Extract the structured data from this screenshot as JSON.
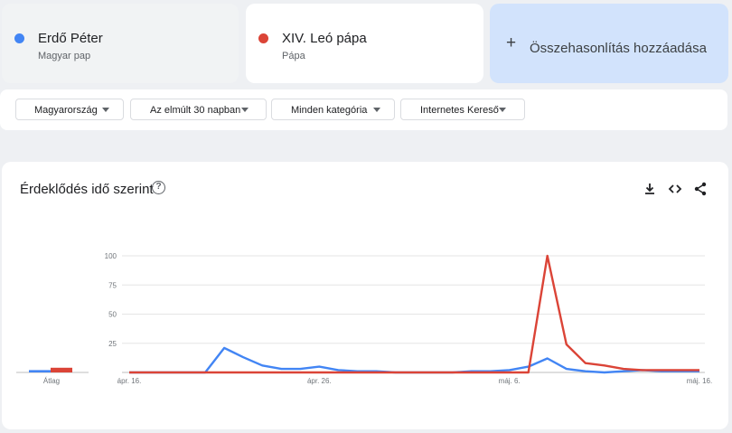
{
  "terms": [
    {
      "name": "Erdő Péter",
      "subtitle": "Magyar pap",
      "color": "#4285f4"
    },
    {
      "name": "XIV. Leó pápa",
      "subtitle": "Pápa",
      "color": "#db4437"
    }
  ],
  "add_compare": {
    "label": "Összehasonlítás hozzáadása",
    "icon": "plus-icon"
  },
  "filters": [
    {
      "label": "Magyarország"
    },
    {
      "label": "Az elmúlt 30 napban"
    },
    {
      "label": "Minden kategória"
    },
    {
      "label": "Internetes Kereső"
    }
  ],
  "chart_card": {
    "title": "Érdeklődés idő szerint",
    "help_icon": "?",
    "tools": [
      "download-icon",
      "embed-icon",
      "share-icon"
    ]
  },
  "chart_data": {
    "type": "line",
    "x_start": "ápr. 16.",
    "x_tick_labels": [
      "ápr. 16.",
      "ápr. 26.",
      "máj. 6.",
      "máj. 16."
    ],
    "x_tick_days": [
      0,
      10,
      20,
      30
    ],
    "ylim": [
      0,
      100
    ],
    "y_ticks": [
      100,
      75,
      50,
      25
    ],
    "grid": true,
    "series": [
      {
        "name": "Erdő Péter",
        "color": "#4285f4",
        "values": [
          0,
          0,
          0,
          0,
          0,
          21,
          13,
          6,
          3,
          3,
          5,
          2,
          1,
          1,
          0,
          0,
          0,
          0,
          1,
          1,
          2,
          5,
          12,
          3,
          1,
          0,
          1,
          2,
          1,
          1,
          1
        ]
      },
      {
        "name": "XIV. Leó pápa",
        "color": "#db4437",
        "values": [
          0,
          0,
          0,
          0,
          0,
          0,
          0,
          0,
          0,
          0,
          0,
          0,
          0,
          0,
          0,
          0,
          0,
          0,
          0,
          0,
          0,
          0,
          100,
          24,
          8,
          6,
          3,
          2,
          2,
          2,
          2
        ]
      }
    ],
    "averages": {
      "label": "Átlag",
      "values": [
        2,
        4
      ]
    }
  }
}
